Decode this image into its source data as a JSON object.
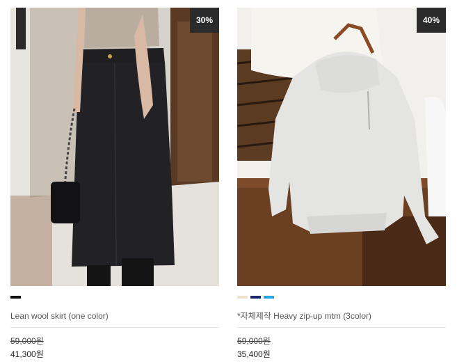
{
  "products": [
    {
      "name": "Lean wool skirt (one color)",
      "discount": "30%",
      "original_price": "59,000원",
      "sale_price": "41,300원",
      "swatches": [
        "#111111"
      ]
    },
    {
      "name": "*자체제작 Heavy zip-up mtm (3color)",
      "discount": "40%",
      "original_price": "59,000원",
      "sale_price": "35,400원",
      "swatches": [
        "#efe3cd",
        "#1a2a6e",
        "#2aa7e0"
      ]
    }
  ]
}
